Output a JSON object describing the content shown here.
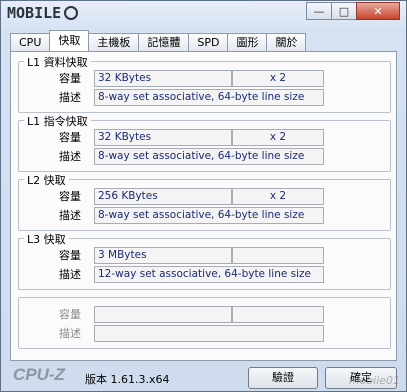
{
  "window": {
    "logo_text": "MOBILE",
    "logo_suffix": "01",
    "minimize_glyph": "—",
    "maximize_glyph": "□",
    "close_glyph": "✕"
  },
  "tabs": [
    {
      "label": "CPU"
    },
    {
      "label": "快取"
    },
    {
      "label": "主機板"
    },
    {
      "label": "記憶體"
    },
    {
      "label": "SPD"
    },
    {
      "label": "圖形"
    },
    {
      "label": "關於"
    }
  ],
  "active_tab_index": 1,
  "groups": [
    {
      "title": "L1 資料快取",
      "size_label": "容量",
      "size_value": "32 KBytes",
      "size_count": "x 2",
      "desc_label": "描述",
      "desc_value": "8-way set associative, 64-byte line size"
    },
    {
      "title": "L1 指令快取",
      "size_label": "容量",
      "size_value": "32 KBytes",
      "size_count": "x 2",
      "desc_label": "描述",
      "desc_value": "8-way set associative, 64-byte line size"
    },
    {
      "title": "L2 快取",
      "size_label": "容量",
      "size_value": "256 KBytes",
      "size_count": "x 2",
      "desc_label": "描述",
      "desc_value": "8-way set associative, 64-byte line size"
    },
    {
      "title": "L3 快取",
      "size_label": "容量",
      "size_value": "3 MBytes",
      "size_count": "",
      "desc_label": "描述",
      "desc_value": "12-way set associative, 64-byte line size"
    },
    {
      "title": "",
      "size_label": "容量",
      "size_value": "",
      "size_count": "",
      "desc_label": "描述",
      "desc_value": ""
    }
  ],
  "footer": {
    "brand": "CPU-Z",
    "version": "版本 1.61.3.x64",
    "validate_label": "驗證",
    "ok_label": "確定",
    "watermark": "mobile01"
  }
}
